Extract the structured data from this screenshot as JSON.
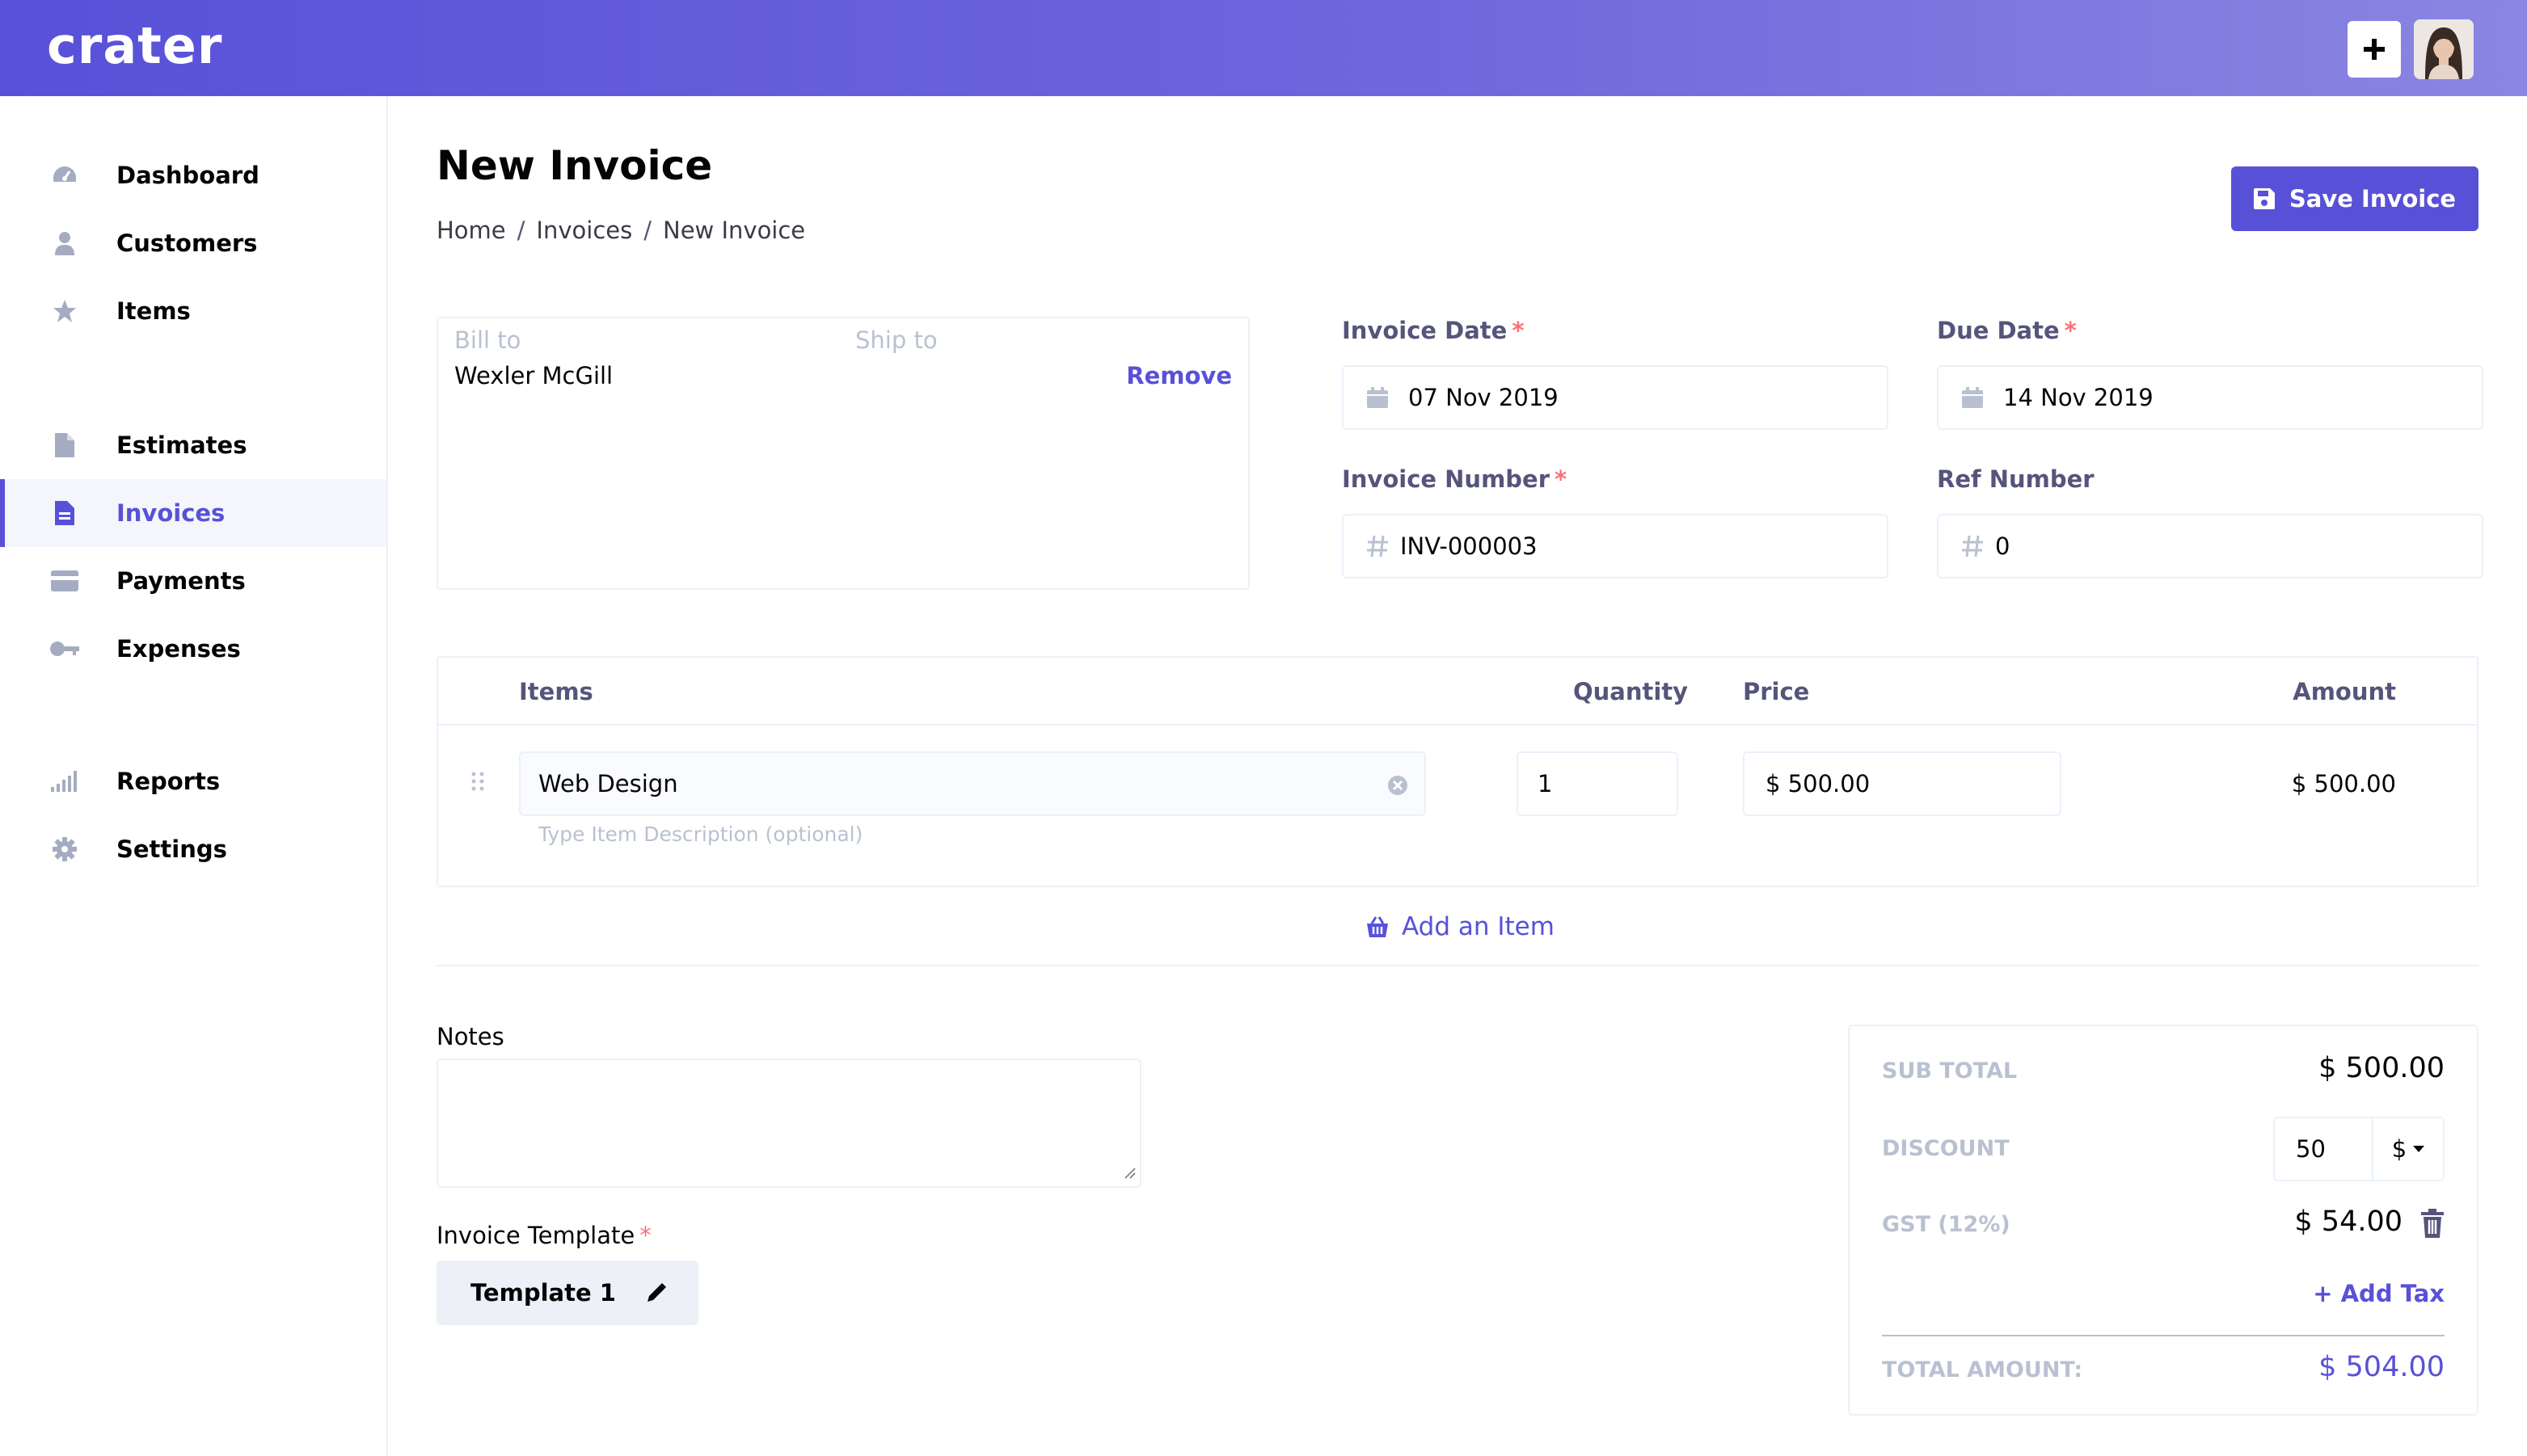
{
  "app": {
    "logo_text": "crater"
  },
  "header": {
    "add_icon": "plus-icon",
    "avatar_icon": "user-avatar"
  },
  "sidebar": {
    "items": [
      {
        "label": "Dashboard",
        "icon": "dashboard-icon"
      },
      {
        "label": "Customers",
        "icon": "user-icon"
      },
      {
        "label": "Items",
        "icon": "star-icon"
      },
      {
        "label": "Estimates",
        "icon": "document-icon"
      },
      {
        "label": "Invoices",
        "icon": "invoice-icon",
        "active": true
      },
      {
        "label": "Payments",
        "icon": "credit-card-icon"
      },
      {
        "label": "Expenses",
        "icon": "key-icon"
      },
      {
        "label": "Reports",
        "icon": "signal-icon"
      },
      {
        "label": "Settings",
        "icon": "gear-icon"
      }
    ]
  },
  "page": {
    "title": "New Invoice",
    "breadcrumb": [
      "Home",
      "Invoices",
      "New Invoice"
    ],
    "save_label": "Save Invoice"
  },
  "billing": {
    "bill_to_label": "Bill to",
    "ship_to_label": "Ship to",
    "customer_name": "Wexler McGill",
    "remove_label": "Remove"
  },
  "fields": {
    "invoice_date": {
      "label": "Invoice Date",
      "required_mark": "*",
      "value": "07 Nov 2019"
    },
    "due_date": {
      "label": "Due Date",
      "required_mark": "*",
      "value": "14 Nov 2019"
    },
    "invoice_number": {
      "label": "Invoice Number",
      "required_mark": "*",
      "value": "INV-000003"
    },
    "ref_number": {
      "label": "Ref Number",
      "value": "0"
    }
  },
  "items_table": {
    "headers": {
      "items": "Items",
      "quantity": "Quantity",
      "price": "Price",
      "amount": "Amount"
    },
    "rows": [
      {
        "name": "Web Design",
        "description_placeholder": "Type Item Description (optional)",
        "quantity": "1",
        "price": "$ 500.00",
        "amount": "$ 500.00"
      }
    ],
    "add_item_label": "Add an Item"
  },
  "notes": {
    "label": "Notes",
    "value": ""
  },
  "template": {
    "label": "Invoice Template",
    "required_mark": "*",
    "value": "Template 1"
  },
  "totals": {
    "sub_total_label": "SUB TOTAL",
    "sub_total_value": "$ 500.00",
    "discount_label": "DISCOUNT",
    "discount_value": "50",
    "discount_unit": "$",
    "tax_label": "GST (12%)",
    "tax_value": "$ 54.00",
    "add_tax_label": "+ Add Tax",
    "total_label": "TOTAL AMOUNT:",
    "total_value": "$ 504.00"
  },
  "colors": {
    "primary": "#5851d8",
    "border": "#ebf1fa",
    "muted": "#b9c1d1",
    "label": "#55547a",
    "required": "#fb7178"
  }
}
